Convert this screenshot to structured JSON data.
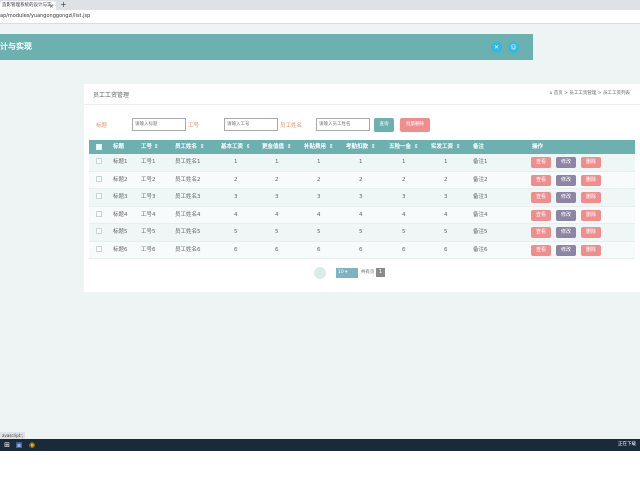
{
  "browser": {
    "tab_title": "造影管理系统的设计与实…",
    "url": "ap/modules/yuangonggongzi/list.jsp"
  },
  "header": {
    "title": "计与实现",
    "btn1_icon": "close-icon",
    "btn2_icon": "user-icon"
  },
  "page": {
    "title": "员工工资管理",
    "breadcrumb": "⌂ 首页 > 员工工资管理 > 员工工资列表"
  },
  "filters": {
    "label_title": "标题",
    "ph_title": "请输入标题",
    "label_no": "工号",
    "ph_no": "请输入工号",
    "label_name": "员工姓名",
    "ph_name": "请输入员工姓名",
    "search": "查询",
    "bulk_delete": "批量删除"
  },
  "table": {
    "headers": [
      "标题",
      "工号",
      "员工姓名",
      "基本工资",
      "更金值值",
      "补贴费用",
      "考勤扣款",
      "五险一金",
      "实发工资",
      "备注",
      "操作"
    ],
    "sort_mark": "⇕",
    "rows": [
      [
        "标题1",
        "工号1",
        "员工姓名1",
        "1",
        "1",
        "1",
        "1",
        "1",
        "1",
        "备注1"
      ],
      [
        "标题2",
        "工号2",
        "员工姓名2",
        "2",
        "2",
        "2",
        "2",
        "2",
        "2",
        "备注2"
      ],
      [
        "标题3",
        "工号3",
        "员工姓名3",
        "3",
        "3",
        "3",
        "3",
        "3",
        "3",
        "备注3"
      ],
      [
        "标题4",
        "工号4",
        "员工姓名4",
        "4",
        "4",
        "4",
        "4",
        "4",
        "4",
        "备注4"
      ],
      [
        "标题5",
        "工号5",
        "员工姓名5",
        "5",
        "5",
        "5",
        "5",
        "5",
        "5",
        "备注5"
      ],
      [
        "标题6",
        "工号6",
        "员工姓名6",
        "6",
        "6",
        "6",
        "6",
        "6",
        "6",
        "备注6"
      ]
    ],
    "actions": {
      "view": "查看",
      "edit": "修改",
      "delete": "删除"
    }
  },
  "pager": {
    "page_size": "10 ▾",
    "total_label": "共有页",
    "current": "1"
  },
  "statusbar": {
    "link": "avascript:;"
  },
  "taskbar": {
    "right_text": "正在下载"
  },
  "colors": {
    "header": "#6cb1b0",
    "danger": "#f08d8d",
    "edit": "#8e84a3"
  }
}
